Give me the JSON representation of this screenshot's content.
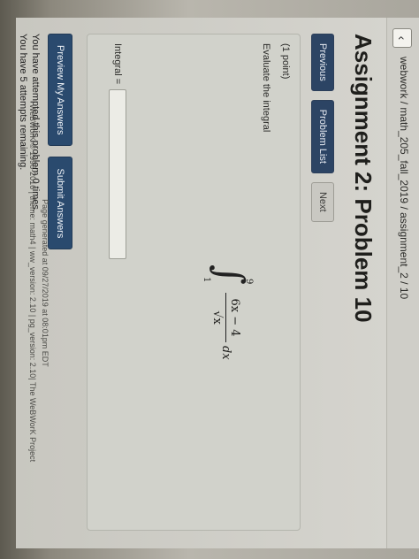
{
  "breadcrumb": {
    "back_glyph": "‹",
    "path": "webwork / math_205_fall_2019 / assignment_2 / 10"
  },
  "page": {
    "title": "Assignment 2: Problem 10"
  },
  "nav": {
    "previous": "Previous",
    "problem_list": "Problem List",
    "next": "Next"
  },
  "problem": {
    "points": "(1 point)",
    "prompt": "Evaluate the integral",
    "integral": {
      "sign": "∫",
      "upper": "9",
      "lower": "1",
      "numerator": "6x − 4",
      "denominator": "√x",
      "dx": "dx"
    },
    "answer_label": "Integral =",
    "answer_value": ""
  },
  "actions": {
    "preview": "Preview My Answers",
    "submit": "Submit Answers"
  },
  "status": {
    "attempts": "You have attempted this problem 0 times.",
    "remaining": "You have 5 attempts remaining."
  },
  "footer": {
    "generated": "Page generated at 09/27/2019 at 08:01pm EDT",
    "credits": "WeBWorK © 1996-2016 | theme: math4 | ww_version: 2.10 | pg_version: 2.10| The WeBWorK Project"
  },
  "colors": {
    "button_primary": "#2a4a6e",
    "screen_bg": "#d6d5cf"
  }
}
